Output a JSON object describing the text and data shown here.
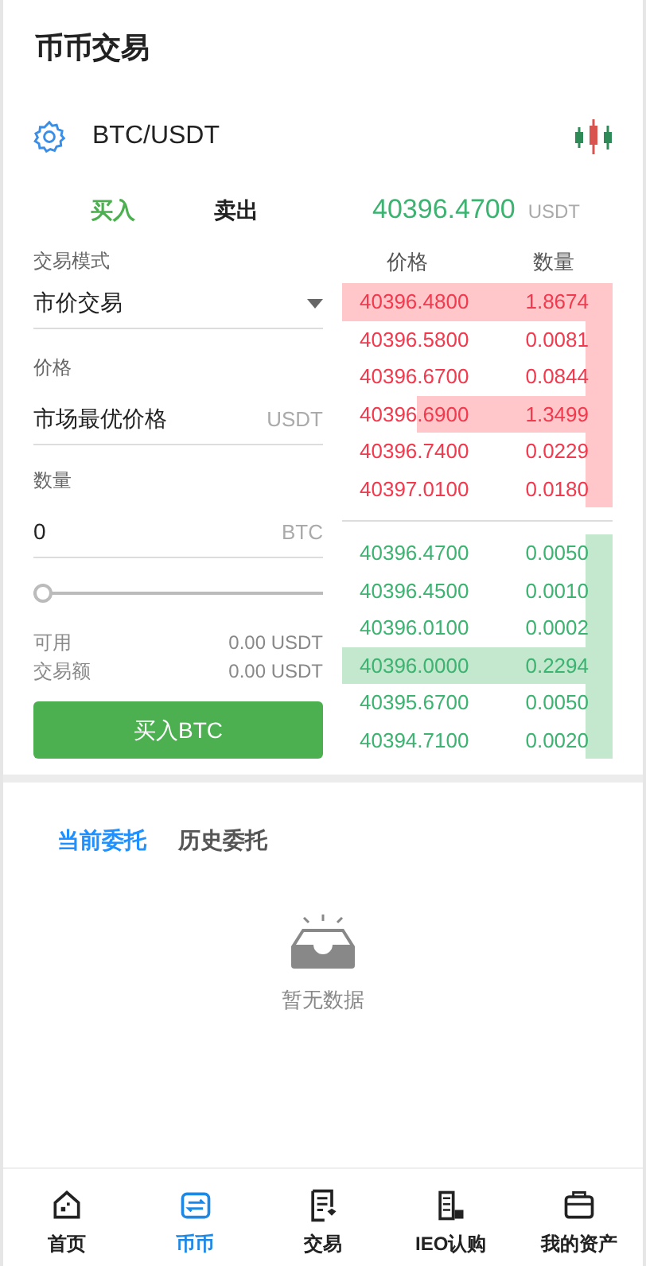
{
  "header": {
    "title": "币币交易"
  },
  "pair": {
    "symbol": "BTC/USDT"
  },
  "side_tabs": [
    {
      "label": "买入",
      "selected": true
    },
    {
      "label": "卖出",
      "selected": false
    }
  ],
  "last_price": {
    "value": "40396.4700",
    "unit": "USDT"
  },
  "form": {
    "mode_label": "交易模式",
    "mode_value": "市价交易",
    "price_label": "价格",
    "price_value": "市场最优价格",
    "price_unit": "USDT",
    "amount_label": "数量",
    "amount_value": "0",
    "amount_unit": "BTC",
    "slider": {
      "level": 0
    },
    "available_label": "可用",
    "available_value": "0.00 USDT",
    "total_label": "交易额",
    "total_value": "0.00 USDT",
    "submit": "买入BTC"
  },
  "orderbook": {
    "columns": [
      "价格",
      "数量"
    ],
    "asks": [
      {
        "price": "40396.4800",
        "amount": "1.8674"
      },
      {
        "price": "40396.5800",
        "amount": "0.0081"
      },
      {
        "price": "40396.6700",
        "amount": "0.0844"
      },
      {
        "price": "40396.6900",
        "amount": "1.3499"
      },
      {
        "price": "40396.7400",
        "amount": "0.0229"
      },
      {
        "price": "40397.0100",
        "amount": "0.0180"
      }
    ],
    "bids": [
      {
        "price": "40396.4700",
        "amount": "0.0050"
      },
      {
        "price": "40396.4500",
        "amount": "0.0010"
      },
      {
        "price": "40396.0100",
        "amount": "0.0002"
      },
      {
        "price": "40396.0000",
        "amount": "0.2294"
      },
      {
        "price": "40395.6700",
        "amount": "0.0050"
      },
      {
        "price": "40394.7100",
        "amount": "0.0020"
      }
    ]
  },
  "order_tabs": [
    {
      "label": "当前委托",
      "selected": true
    },
    {
      "label": "历史委托",
      "selected": false
    }
  ],
  "empty_text": "暂无数据",
  "nav": [
    {
      "kind": "home",
      "label": "首页",
      "selected": false
    },
    {
      "kind": "coin",
      "label": "币币",
      "selected": true
    },
    {
      "kind": "trade",
      "label": "交易",
      "selected": false
    },
    {
      "kind": "ieo",
      "label": "IEO认购",
      "selected": false
    },
    {
      "kind": "assets",
      "label": "我的资产",
      "selected": false
    }
  ]
}
